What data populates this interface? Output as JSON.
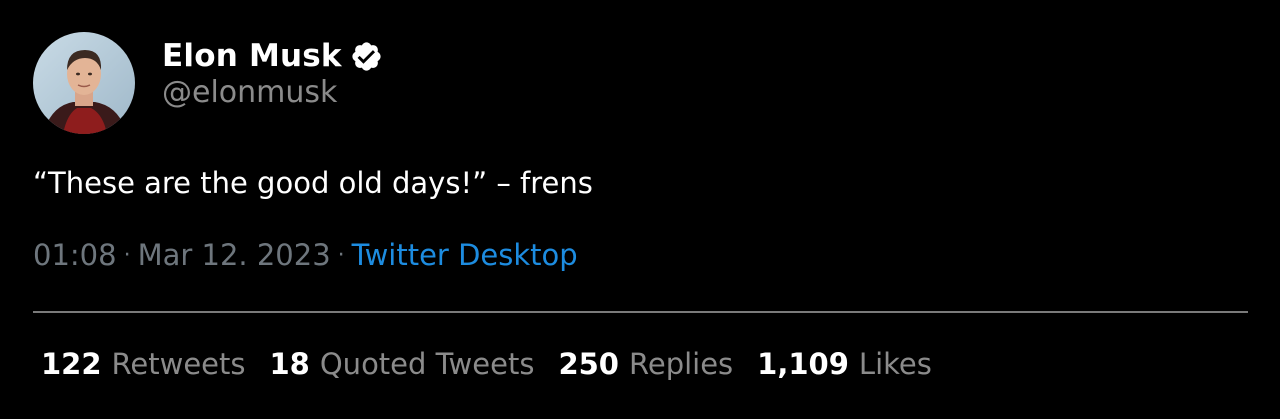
{
  "user": {
    "display_name": "Elon Musk",
    "handle": "@elonmusk",
    "verified_icon": "verified-badge-icon",
    "avatar_icon": "avatar"
  },
  "tweet": {
    "text": "“These are the good old days!” – frens"
  },
  "meta": {
    "time": "01:08",
    "separator": "·",
    "date": "Mar 12. 2023",
    "source": "Twitter Desktop"
  },
  "stats": [
    {
      "count": "122",
      "label": "Retweets"
    },
    {
      "count": "18",
      "label": "Quoted Tweets"
    },
    {
      "count": "250",
      "label": "Replies"
    },
    {
      "count": "1,109",
      "label": "Likes"
    }
  ],
  "colors": {
    "background": "#000000",
    "primary_text": "#ffffff",
    "secondary_text": "#8b8b8b",
    "link": "#1d8ce0",
    "divider": "#7a7a7a"
  }
}
